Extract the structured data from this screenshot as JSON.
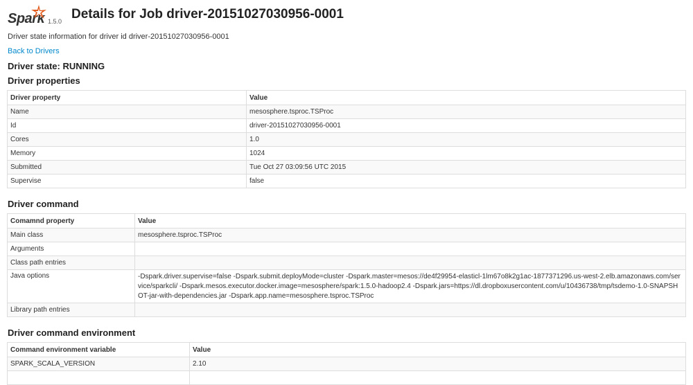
{
  "header": {
    "logo_word": "Spark",
    "logo_version": "1.5.0",
    "title": "Details for Job driver-20151027030956-0001"
  },
  "info": "Driver state information for driver id driver-20151027030956-0001",
  "back_link": "Back to Drivers",
  "state": "Driver state: RUNNING",
  "properties": {
    "heading": "Driver properties",
    "columns": [
      "Driver property",
      "Value"
    ],
    "rows": [
      [
        "Name",
        "mesosphere.tsproc.TSProc"
      ],
      [
        "Id",
        "driver-20151027030956-0001"
      ],
      [
        "Cores",
        "1.0"
      ],
      [
        "Memory",
        "1024"
      ],
      [
        "Submitted",
        "Tue Oct 27 03:09:56 UTC 2015"
      ],
      [
        "Supervise",
        "false"
      ]
    ]
  },
  "command": {
    "heading": "Driver command",
    "columns": [
      "Comamnd property",
      "Value"
    ],
    "rows": [
      [
        "Main class",
        "mesosphere.tsproc.TSProc"
      ],
      [
        "Arguments",
        ""
      ],
      [
        "Class path entries",
        ""
      ],
      [
        "Java options",
        "-Dspark.driver.supervise=false -Dspark.submit.deployMode=cluster -Dspark.master=mesos://de4f29954-elasticl-1lm67o8k2g1ac-1877371296.us-west-2.elb.amazonaws.com/service/sparkcli/ -Dspark.mesos.executor.docker.image=mesosphere/spark:1.5.0-hadoop2.4 -Dspark.jars=https://dl.dropboxusercontent.com/u/10436738/tmp/tsdemo-1.0-SNAPSHOT-jar-with-dependencies.jar -Dspark.app.name=mesosphere.tsproc.TSProc"
      ],
      [
        "Library path entries",
        ""
      ]
    ]
  },
  "environment": {
    "heading": "Driver command environment",
    "columns": [
      "Command environment variable",
      "Value"
    ],
    "rows": [
      [
        "SPARK_SCALA_VERSION",
        "2.10"
      ],
      [
        "",
        ""
      ]
    ]
  }
}
